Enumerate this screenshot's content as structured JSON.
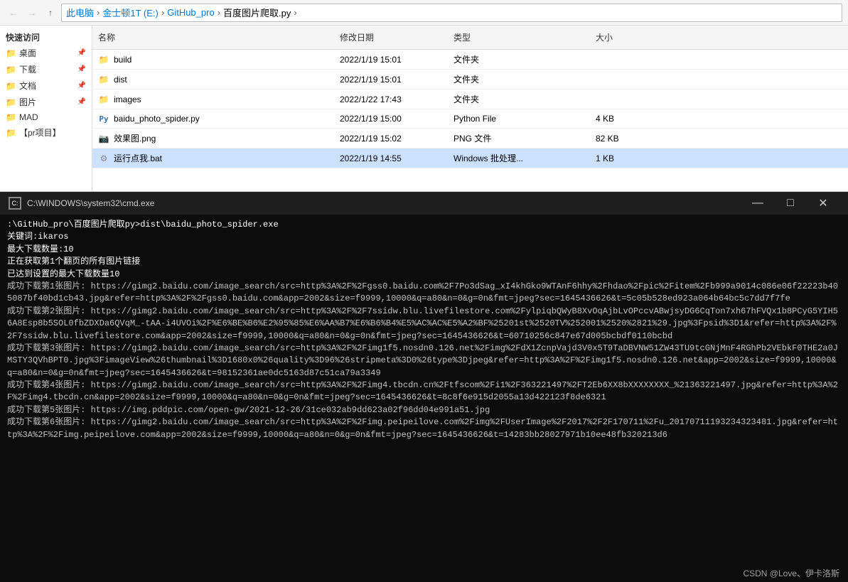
{
  "toolbar": {
    "back_label": "←",
    "forward_label": "→",
    "up_label": "↑"
  },
  "breadcrumb": {
    "parts": [
      "此电脑",
      "金士顿1T (E:)",
      "GitHub_pro",
      "百度图片爬取.py"
    ],
    "separator": "›"
  },
  "sidebar": {
    "heading": "快速访问",
    "items": [
      {
        "label": "桌面",
        "pinned": true
      },
      {
        "label": "下载",
        "pinned": true
      },
      {
        "label": "文档",
        "pinned": true
      },
      {
        "label": "图片",
        "pinned": true
      },
      {
        "label": "MAD",
        "pinned": false
      },
      {
        "label": "【pr项目】",
        "pinned": false
      }
    ]
  },
  "file_list": {
    "columns": [
      "名称",
      "修改日期",
      "类型",
      "大小"
    ],
    "rows": [
      {
        "name": "build",
        "date": "2022/1/19 15:01",
        "type": "文件夹",
        "size": "",
        "icon": "folder",
        "selected": false
      },
      {
        "name": "dist",
        "date": "2022/1/19 15:01",
        "type": "文件夹",
        "size": "",
        "icon": "folder",
        "selected": false
      },
      {
        "name": "images",
        "date": "2022/1/22 17:43",
        "type": "文件夹",
        "size": "",
        "icon": "folder",
        "selected": false
      },
      {
        "name": "baidu_photo_spider.py",
        "date": "2022/1/19 15:00",
        "type": "Python File",
        "size": "4 KB",
        "icon": "py",
        "selected": false
      },
      {
        "name": "效果图.png",
        "date": "2022/1/19 15:02",
        "type": "PNG 文件",
        "size": "82 KB",
        "icon": "png",
        "selected": false
      },
      {
        "name": "运行点我.bat",
        "date": "2022/1/19 14:55",
        "type": "Windows 批处理...",
        "size": "1 KB",
        "icon": "bat",
        "selected": true
      }
    ]
  },
  "cmd": {
    "title": "C:\\WINDOWS\\system32\\cmd.exe",
    "icon_label": "C:",
    "controls": {
      "minimize": "—",
      "maximize": "□",
      "close": "✕"
    },
    "lines": [
      {
        "text": ":\\GitHub_pro\\百度图片爬取py>dist\\baidu_photo_spider.exe",
        "color": "white"
      },
      {
        "text": "关键词:ikaros",
        "color": "white"
      },
      {
        "text": "最大下载数量:10",
        "color": "white"
      },
      {
        "text": "正在获取第1个翻页的所有图片链接",
        "color": "white"
      },
      {
        "text": "已达到设置的最大下载数量10",
        "color": "white"
      },
      {
        "text": "成功下载第1张图片: https://gimg2.baidu.com/image_search/src=http%3A%2F%2Fgss0.baidu.com%2F7Po3dSag_xI4khGko9WTAnF6hhy%2Fhdao%2Fpic%2Fitem%2Fb999a9014c086e06f22223b405087bf40bd1cb43.jpg&refer=http%3A%2F%2Fgss0.baidu.com&app=2002&size=f9999,10000&q=a80&n=0&g=0n&fmt=jpeg?sec=1645436626&t=5c05b528ed923a064b64bc5c7dd7f7fe",
        "color": "gray"
      },
      {
        "text": "成功下载第2张图片: https://gimg2.baidu.com/image_search/src=http%3A%2F%2F7ssidw.blu.livefilestore.com%2FylpiqbQWyB8XvOqAjbLvOPccvABwjsyDG6CqTon7xh67hFVQx1b8PCyG5YIH56A8Esp8b5SOL0fbZDXDa6QVqM_-tAA-i4UVOi%2F%E6%BE%B6%E2%95%85%E6%AA%B7%E6%B6%B4%E5%AC%AC%E5%A2%BF%25201st%2520TV%252001%2520%2821%29.jpg%3Fpsid%3D1&refer=http%3A%2F%2F7ssidw.blu.livefilestore.com&app=2002&size=f9999,10000&q=a80&n=0&g=0n&fmt=jpeg?sec=1645436626&t=60710256c847e67d005bcbdf0110bcbd",
        "color": "gray"
      },
      {
        "text": "成功下载第3张图片: https://gimg2.baidu.com/image_search/src=http%3A%2F%2Fimg1f5.nosdn0.126.net%2Fimg%2FdX1ZcnpVajd3V0x5T9TaDBVNW51ZW43TU9tcGNjMnF4RGhPb2VEbkF0THE2a0JMSTY3QVhBPT0.jpg%3FimageView%26thumbnail%3D1680x0%26quality%3D96%26stripmeta%3D0%26type%3Djpeg&refer=http%3A%2F%2Fimg1f5.nosdn0.126.net&app=2002&size=f9999,10000&q=a80&n=0&g=0n&fmt=jpeg?sec=1645436626&t=98152361ae0dc5163d87c51ca79a3349",
        "color": "gray"
      },
      {
        "text": "成功下载第4张图片: https://gimg2.baidu.com/image_search/src=http%3A%2F%2Fimg4.tbcdn.cn%2Ftfscom%2Fi1%2F363221497%2FT2Eb6XX8bXXXXXXXX_%21363221497.jpg&refer=http%3A%2F%2Fimg4.tbcdn.cn&app=2002&size=f9999,10000&q=a80&n=0&g=0n&fmt=jpeg?sec=1645436626&t=8c8f6e915d2055a13d422123f8de6321",
        "color": "gray"
      },
      {
        "text": "成功下载第5张图片: https://img.pddpic.com/open-gw/2021-12-26/31ce032ab9dd623a02f96dd04e991a51.jpg",
        "color": "gray"
      },
      {
        "text": "成功下载第6张图片: https://gimg2.baidu.com/image_search/src=http%3A%2F%2Fimg.peipeilove.com%2Fimg%2FUserImage%2F2017%2F2F170711%2Fu_20170711193234323481.jpg&refer=http%3A%2F%2Fimg.peipeilove.com&app=2002&size=f9999,10000&q=a80&n=0&g=0n&fmt=jpeg?sec=1645436626&t=14283bb28027971b10ee48fb320213d6",
        "color": "gray"
      }
    ],
    "footer": "CSDN @Love、伊卡洛斯"
  }
}
